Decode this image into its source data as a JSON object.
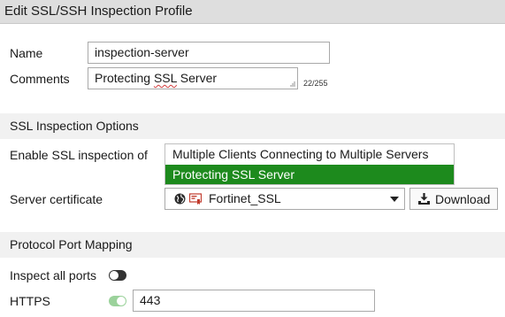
{
  "header": {
    "title": "Edit SSL/SSH Inspection Profile"
  },
  "form": {
    "name_label": "Name",
    "name_value": "inspection-server",
    "comments_label": "Comments",
    "comments_value_prefix": "Protecting ",
    "comments_value_flagged": "SSL",
    "comments_value_suffix": " Server",
    "comments_counter": "22/255"
  },
  "ssl_section": {
    "title": "SSL Inspection Options",
    "enable_label": "Enable SSL inspection of",
    "options": [
      "Multiple Clients Connecting to Multiple Servers",
      "Protecting SSL Server"
    ],
    "selected_option": "Protecting SSL Server",
    "server_cert_label": "Server certificate",
    "server_cert_value": "Fortinet_SSL",
    "download_label": "Download"
  },
  "port_section": {
    "title": "Protocol Port Mapping",
    "inspect_all_label": "Inspect all ports",
    "inspect_all_enabled": false,
    "https_label": "HTTPS",
    "https_enabled": true,
    "https_port": "443"
  },
  "colors": {
    "selected_option_bg": "#1d8a1d",
    "toggle_on": "#9bd29b",
    "toggle_off": "#333333",
    "cert_icon_red": "#c0392b"
  },
  "icons": [
    "globe-icon",
    "certificate-icon",
    "chevron-down-icon",
    "download-icon",
    "resize-grip-icon"
  ]
}
